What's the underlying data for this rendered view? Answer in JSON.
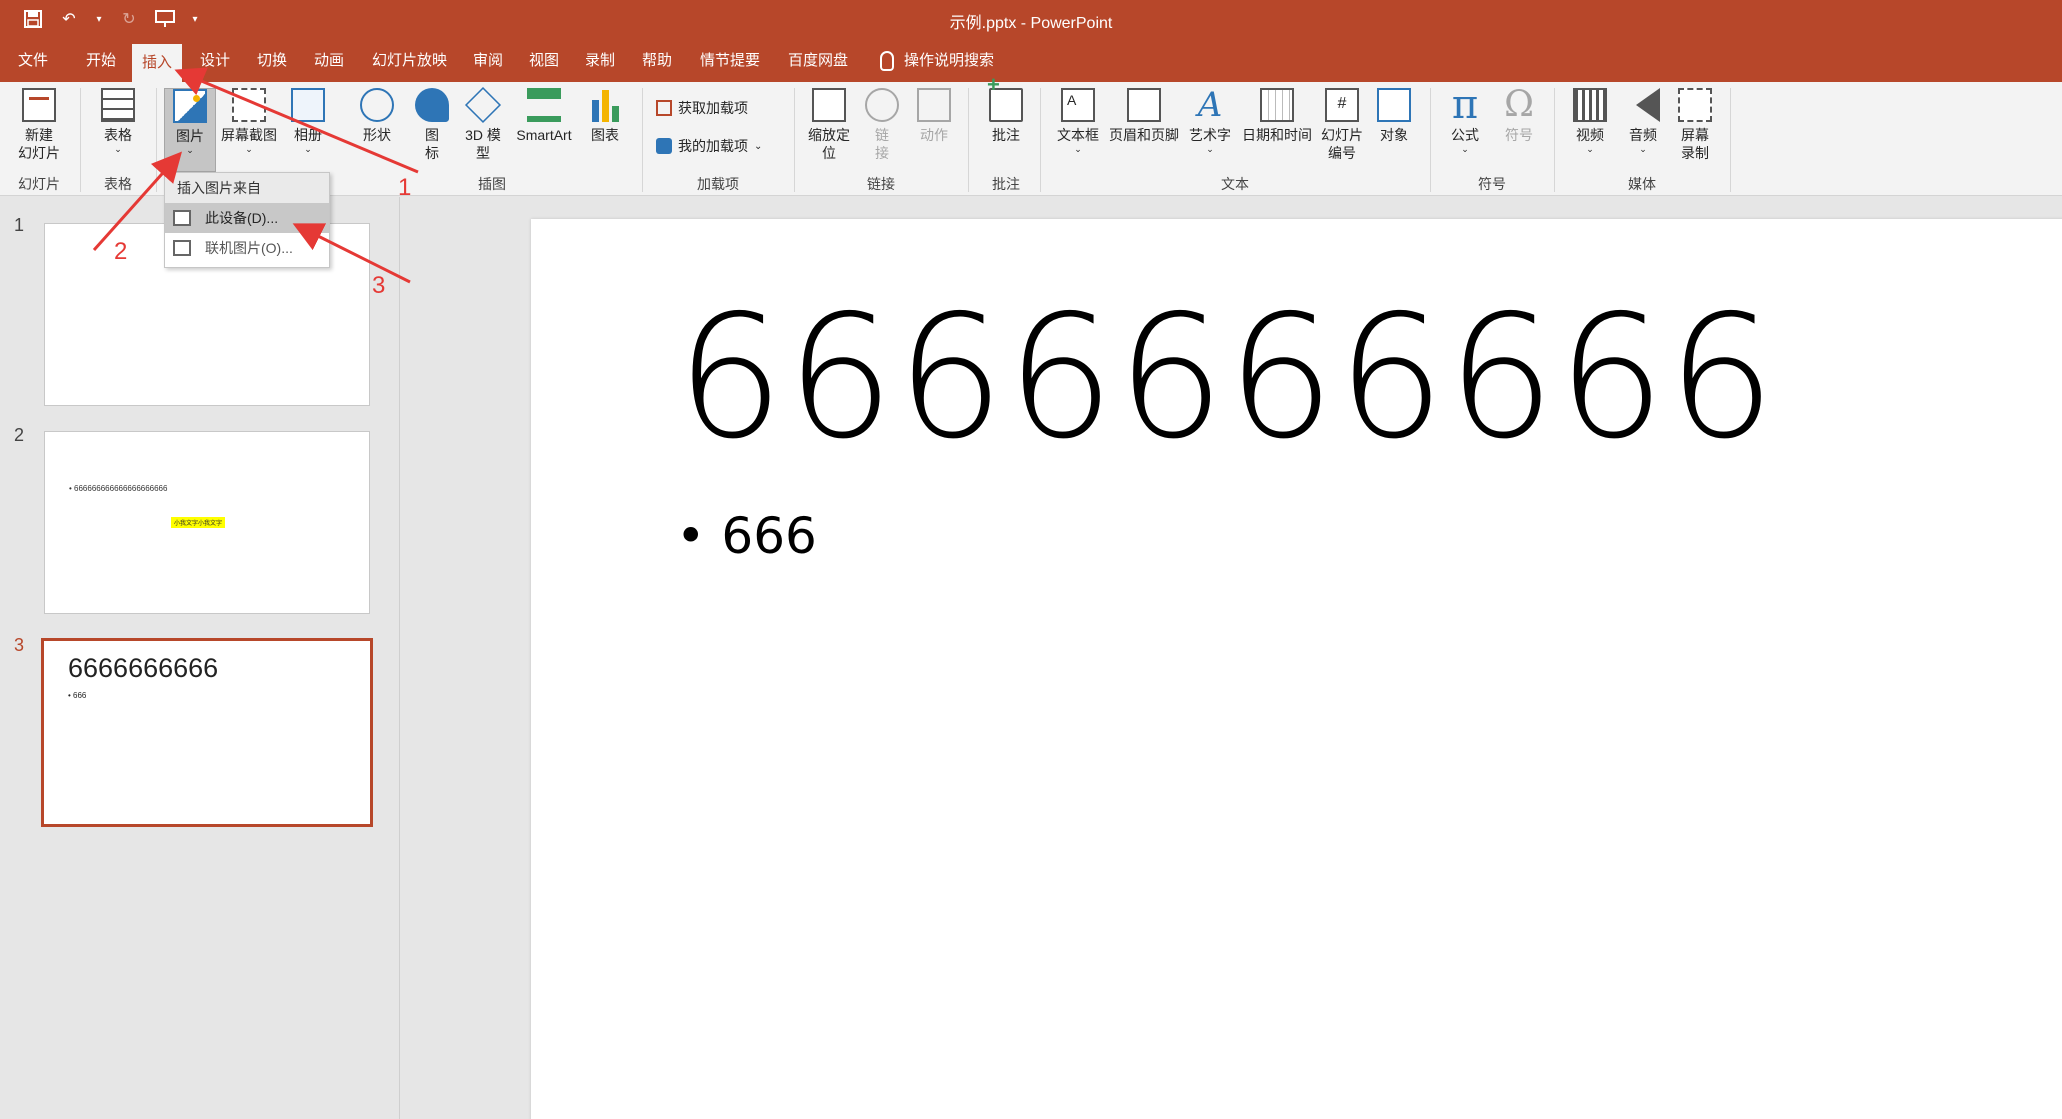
{
  "window": {
    "title": "示例.pptx  -  PowerPoint"
  },
  "qat": {
    "save": "save-icon",
    "undo": "undo-icon",
    "redo": "redo-icon",
    "present": "start-presentation-icon"
  },
  "tabs": [
    {
      "label": "文件"
    },
    {
      "label": "开始"
    },
    {
      "label": "插入"
    },
    {
      "label": "设计"
    },
    {
      "label": "切换"
    },
    {
      "label": "动画"
    },
    {
      "label": "幻灯片放映"
    },
    {
      "label": "审阅"
    },
    {
      "label": "视图"
    },
    {
      "label": "录制"
    },
    {
      "label": "帮助"
    },
    {
      "label": "情节提要"
    },
    {
      "label": "百度网盘"
    }
  ],
  "tell_me": "操作说明搜索",
  "ribbon": {
    "groups": {
      "slides": "幻灯片",
      "tables": "表格",
      "illustrations": "插图",
      "addins": "加载项",
      "links": "链接",
      "comments": "批注",
      "text": "文本",
      "symbols": "符号",
      "media": "媒体"
    },
    "buttons": {
      "new_slide_1": "新建",
      "new_slide_2": "幻灯片",
      "table": "表格",
      "picture": "图片",
      "screenshot": "屏幕截图",
      "album": "相册",
      "shapes": "形状",
      "icons_1": "图",
      "icons_2": "标",
      "model_1": "3D 模",
      "model_2": "型",
      "smartart": "SmartArt",
      "chart": "图表",
      "get_addins": "获取加载项",
      "my_addins": "我的加载项",
      "zoom_1": "缩放定",
      "zoom_2": "位",
      "link_1": "链",
      "link_2": "接",
      "action": "动作",
      "comment": "批注",
      "textbox": "文本框",
      "header_footer": "页眉和页脚",
      "wordart": "艺术字",
      "datetime": "日期和时间",
      "slide_number_1": "幻灯片",
      "slide_number_2": "编号",
      "object": "对象",
      "equation": "公式",
      "symbol": "符号",
      "video": "视频",
      "audio": "音频",
      "screen_record_1": "屏幕",
      "screen_record_2": "录制",
      "textbox_icon_letter": "A",
      "slide_number_icon_char": "#"
    }
  },
  "dropdown": {
    "header": "插入图片来自",
    "items": [
      {
        "label": "此设备(D)..."
      },
      {
        "label": "联机图片(O)..."
      }
    ]
  },
  "slides": [
    {
      "number": "1"
    },
    {
      "number": "2",
      "bullet": "• 666666666666666666666",
      "highlight": "小我文字小我文字"
    },
    {
      "number": "3",
      "title": "6666666666",
      "bullet": "• 666"
    }
  ],
  "current_slide": {
    "title": "6666666666",
    "bullet": "• 666"
  },
  "annotations": [
    "1",
    "2",
    "3"
  ],
  "colors": {
    "accent": "#b7472a",
    "arrow": "#e53935"
  }
}
